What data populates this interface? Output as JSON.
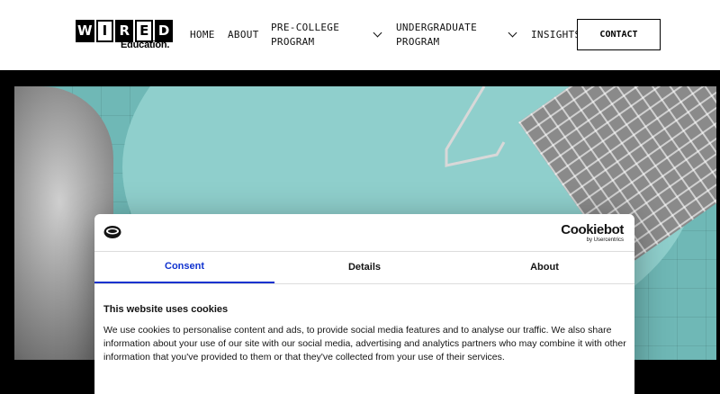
{
  "header": {
    "logo": {
      "letters": [
        "W",
        "I",
        "R",
        "E",
        "D"
      ],
      "subtitle": "Education."
    },
    "nav": [
      {
        "label": "HOME"
      },
      {
        "label": "ABOUT"
      },
      {
        "label_lines": [
          "PRE-COLLEGE",
          "PROGRAM"
        ],
        "has_dropdown": true
      },
      {
        "label_lines": [
          "UNDERGRADUATE",
          "PROGRAM"
        ],
        "has_dropdown": true
      },
      {
        "label": "INSIGHTS"
      }
    ],
    "contact_label": "CONTACT"
  },
  "cookie_banner": {
    "brand_name": "Cookiebot",
    "brand_by": "by Usercentrics",
    "tabs": [
      {
        "label": "Consent",
        "active": true
      },
      {
        "label": "Details",
        "active": false
      },
      {
        "label": "About",
        "active": false
      }
    ],
    "title": "This website uses cookies",
    "body": "We use cookies to personalise content and ads, to provide social media features and to analyse our traffic. We also share information about your use of our site with our social media, advertising and analytics partners who may combine it with other information that you've provided to them or that they've collected from your use of their services."
  },
  "colors": {
    "accent_tab": "#1032cf",
    "hero_teal": "#6fb8b6",
    "background": "#000000"
  }
}
